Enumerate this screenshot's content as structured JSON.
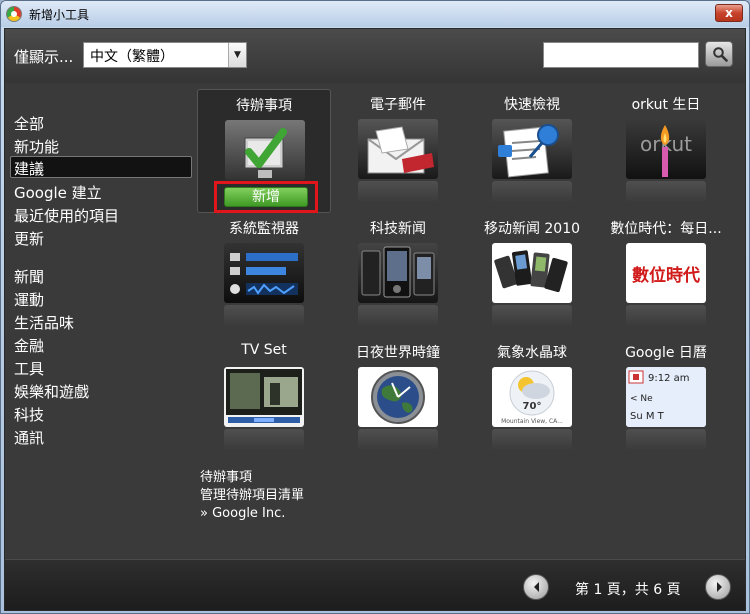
{
  "window": {
    "title": "新增小工具",
    "close_glyph": "x"
  },
  "toolbar": {
    "filter_label": "僅顯示...",
    "language_selected": "中文（繁體）",
    "search_value": "",
    "search_placeholder": ""
  },
  "sidebar": {
    "items": [
      {
        "label": "全部"
      },
      {
        "label": "新功能"
      },
      {
        "label": "建議",
        "selected": true
      },
      {
        "label": "Google 建立"
      },
      {
        "label": "最近使用的項目"
      },
      {
        "label": "更新"
      },
      {
        "label": "新聞"
      },
      {
        "label": "運動"
      },
      {
        "label": "生活品味"
      },
      {
        "label": "金融"
      },
      {
        "label": "工具"
      },
      {
        "label": "娛樂和遊戲"
      },
      {
        "label": "科技"
      },
      {
        "label": "通訊"
      }
    ]
  },
  "gadgets": [
    {
      "title": "待辦事項",
      "icon": "checkmark-todo-icon",
      "selected": true
    },
    {
      "title": "電子郵件",
      "icon": "email-envelope-icon"
    },
    {
      "title": "快速檢視",
      "icon": "pushpin-document-icon"
    },
    {
      "title": "orkut 生日",
      "icon": "birthday-candle-icon"
    },
    {
      "title": "系統監視器",
      "icon": "system-monitor-icon"
    },
    {
      "title": "科技新闻",
      "icon": "phones-icon"
    },
    {
      "title": "移动新闻 2010",
      "icon": "mobile-phones-icon"
    },
    {
      "title": "數位時代：每日...",
      "icon": "digital-times-logo-icon"
    },
    {
      "title": "TV Set",
      "icon": "tv-screen-icon"
    },
    {
      "title": "日夜世界時鐘",
      "icon": "globe-clock-icon"
    },
    {
      "title": "氣象水晶球",
      "icon": "weather-icon"
    },
    {
      "title": "Google 日曆",
      "icon": "calendar-icon"
    }
  ],
  "thumb_text": {
    "orkut": "orkut",
    "digital": "數位時代",
    "calendar_time": "9:12 am",
    "calendar_days": "Su   M   T",
    "calendar_nav": "<           Ne",
    "weather_temp": "70°",
    "weather_loc": "Mountain View, CA..."
  },
  "add_button_label": "新增",
  "detail": {
    "name": "待辦事項",
    "description": "管理待辦項目清單",
    "author": "» Google Inc."
  },
  "pager": {
    "text": "第 1 頁，共 6 頁"
  },
  "colors": {
    "highlight_border": "#e0161b",
    "add_button_green": "#4ea62f",
    "background_dark": "#3a3a3a"
  }
}
